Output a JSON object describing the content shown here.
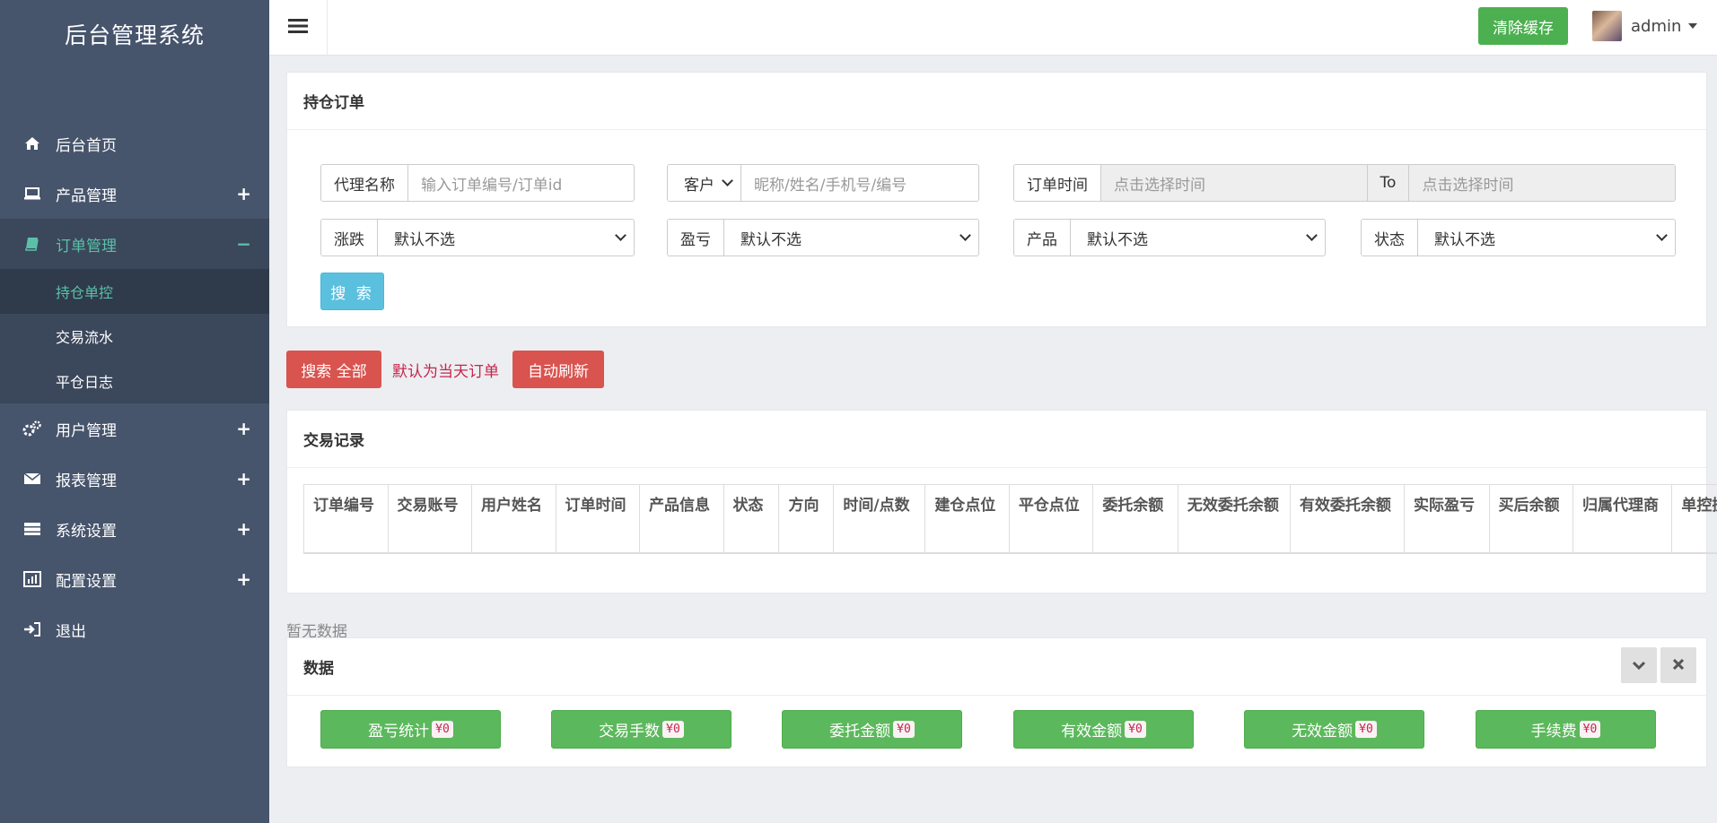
{
  "app": {
    "title": "后台管理系统"
  },
  "sidebar": {
    "items": [
      {
        "label": "后台首页",
        "icon": "home-icon"
      },
      {
        "label": "产品管理",
        "icon": "laptop-icon",
        "toggle": "+"
      },
      {
        "label": "订单管理",
        "icon": "book-icon",
        "toggle": "−"
      },
      {
        "label": "用户管理",
        "icon": "gears-icon",
        "toggle": "+"
      },
      {
        "label": "报表管理",
        "icon": "envelope-icon",
        "toggle": "+"
      },
      {
        "label": "系统设置",
        "icon": "server-icon",
        "toggle": "+"
      },
      {
        "label": "配置设置",
        "icon": "bar-chart-icon",
        "toggle": "+"
      },
      {
        "label": "退出",
        "icon": "sign-in-icon"
      }
    ],
    "submenu": [
      "持仓单控",
      "交易流水",
      "平仓日志"
    ]
  },
  "topbar": {
    "clear_cache": "清除缓存",
    "username": "admin"
  },
  "filter_panel": {
    "title": "持仓订单",
    "agent_label": "代理名称",
    "agent_placeholder": "输入订单编号/订单id",
    "customer_select": "客户",
    "customer_placeholder": "昵称/姓名/手机号/编号",
    "time_label": "订单时间",
    "time_start_placeholder": "点击选择时间",
    "to_label": "To",
    "time_end_placeholder": "点击选择时间",
    "rise_fall_label": "涨跌",
    "profit_label": "盈亏",
    "product_label": "产品",
    "status_label": "状态",
    "default_option": "默认不选",
    "search_button": "搜 索"
  },
  "actions": {
    "search_all": "搜索 全部",
    "note": "默认为当天订单",
    "auto_refresh": "自动刷新"
  },
  "records_panel": {
    "title": "交易记录",
    "columns": [
      "订单编号",
      "交易账号",
      "用户姓名",
      "订单时间",
      "产品信息",
      "状态",
      "方向",
      "时间/点数",
      "建仓点位",
      "平仓点位",
      "委托余额",
      "无效委托余额",
      "有效委托余额",
      "实际盈亏",
      "买后余额",
      "归属代理商",
      "单控操作"
    ]
  },
  "empty_text": "暂无数据",
  "data_panel": {
    "title": "数据",
    "stats": [
      {
        "label": "盈亏统计",
        "value": "¥0"
      },
      {
        "label": "交易手数",
        "value": "¥0"
      },
      {
        "label": "委托金额",
        "value": "¥0"
      },
      {
        "label": "有效金额",
        "value": "¥0"
      },
      {
        "label": "无效金额",
        "value": "¥0"
      },
      {
        "label": "手续费",
        "value": "¥0"
      }
    ]
  }
}
